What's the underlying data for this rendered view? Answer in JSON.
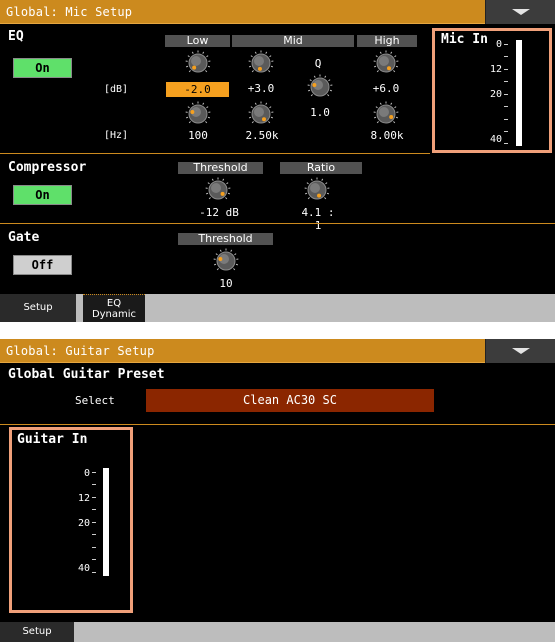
{
  "mic_setup": {
    "window_title": "Global: Mic Setup",
    "eq": {
      "section_title": "EQ",
      "toggle_label": "On",
      "col_low": "Low",
      "col_mid": "Mid",
      "col_high": "High",
      "col_q": "Q",
      "row_db": "[dB]",
      "row_hz": "[Hz]",
      "low_db": "-2.0",
      "mid_db": "+3.0",
      "high_db": "+6.0",
      "mid_q": "1.0",
      "low_hz": "100",
      "mid_hz": "2.50k",
      "high_hz": "8.00k"
    },
    "compressor": {
      "section_title": "Compressor",
      "toggle_label": "On",
      "col_threshold": "Threshold",
      "col_ratio": "Ratio",
      "threshold_value": "-12 dB",
      "ratio_value": "4.1 : 1"
    },
    "gate": {
      "section_title": "Gate",
      "toggle_label": "Off",
      "col_threshold": "Threshold",
      "threshold_value": "10"
    },
    "meter": {
      "title": "Mic In",
      "ticks": [
        "0",
        "12",
        "20",
        "40"
      ]
    },
    "tabs": {
      "setup": "Setup",
      "eq_dynamic_line1": "EQ",
      "eq_dynamic_line2": "Dynamic"
    }
  },
  "guitar_setup": {
    "window_title": "Global: Guitar Setup",
    "preset_title": "Global Guitar Preset",
    "select_label": "Select",
    "select_value": "Clean AC30 SC",
    "meter": {
      "title": "Guitar In",
      "ticks": [
        "0",
        "12",
        "20",
        "40"
      ]
    },
    "tabs": {
      "setup": "Setup"
    }
  },
  "colors": {
    "title_bar": "#cc8a1e",
    "toggle_on": "#5fe06a",
    "toggle_off": "#cfcfcf",
    "selected_value": "#f5a01f",
    "meter_highlight": "#f0a07a",
    "preset_box": "#8b2600"
  },
  "icons": {
    "menu": "triangle-down-icon",
    "knob": "rotary-knob-icon"
  }
}
